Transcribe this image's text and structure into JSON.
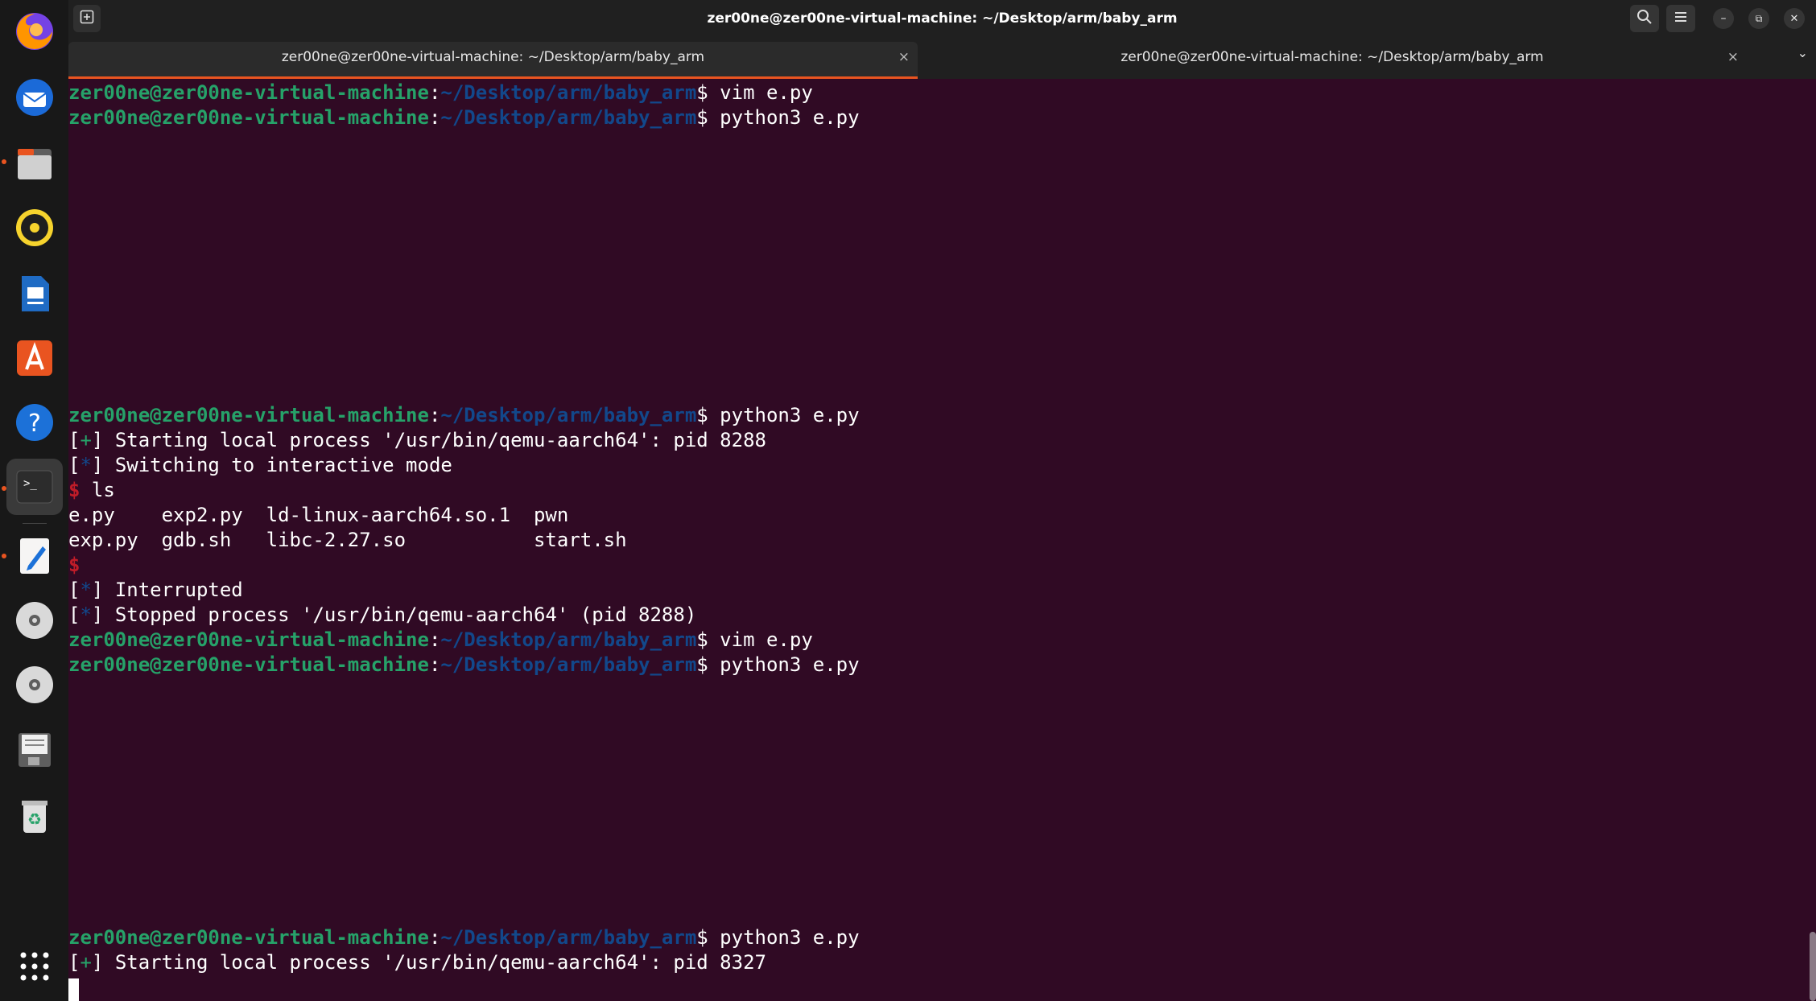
{
  "window": {
    "title": "zer00ne@zer00ne-virtual-machine: ~/Desktop/arm/baby_arm"
  },
  "header": {
    "new_tab_icon": "new-tab-icon",
    "search_icon": "search-icon",
    "menu_icon": "hamburger-menu-icon",
    "minimize": "–",
    "maximize": "⧉",
    "close": "✕"
  },
  "tabs": [
    {
      "label": "zer00ne@zer00ne-virtual-machine: ~/Desktop/arm/baby_arm",
      "close": "×",
      "active": true
    },
    {
      "label": "zer00ne@zer00ne-virtual-machine: ~/Desktop/arm/baby_arm",
      "close": "×",
      "active": false
    }
  ],
  "tab_menu": "⌄",
  "dock": {
    "items": [
      "firefox-icon",
      "thunderbird-icon",
      "files-icon",
      "rhythmbox-icon",
      "libreoffice-writer-icon",
      "app-center-icon",
      "help-icon",
      "terminal-icon",
      "text-editor-icon",
      "disc-icon",
      "disc-icon",
      "document-icon",
      "trash-icon",
      "show-apps-icon"
    ]
  },
  "terminal": {
    "prompt_user": "zer00ne@zer00ne-virtual-machine",
    "prompt_colon": ":",
    "prompt_path": "~/Desktop/arm/baby_arm",
    "prompt_dollar": "$",
    "cmd_vim": " vim e.py",
    "cmd_python": " python3 e.py",
    "start_proc_1": "Starting local process '/usr/bin/qemu-aarch64': pid 8288",
    "switch_mode": "Switching to interactive mode",
    "ls_prompt": "$",
    "ls_cmd": " ls",
    "ls_row1": "e.py    exp2.py  ld-linux-aarch64.so.1  pwn",
    "ls_row2": "exp.py  gdb.sh   libc-2.27.so           start.sh",
    "empty_prompt": "$",
    "interrupted": "Interrupted",
    "stopped": "Stopped process '/usr/bin/qemu-aarch64' (pid 8288)",
    "start_proc_2": "Starting local process '/usr/bin/qemu-aarch64': pid 8327",
    "plus": "+",
    "star": "*",
    "lb": "[",
    "rb": "]"
  }
}
